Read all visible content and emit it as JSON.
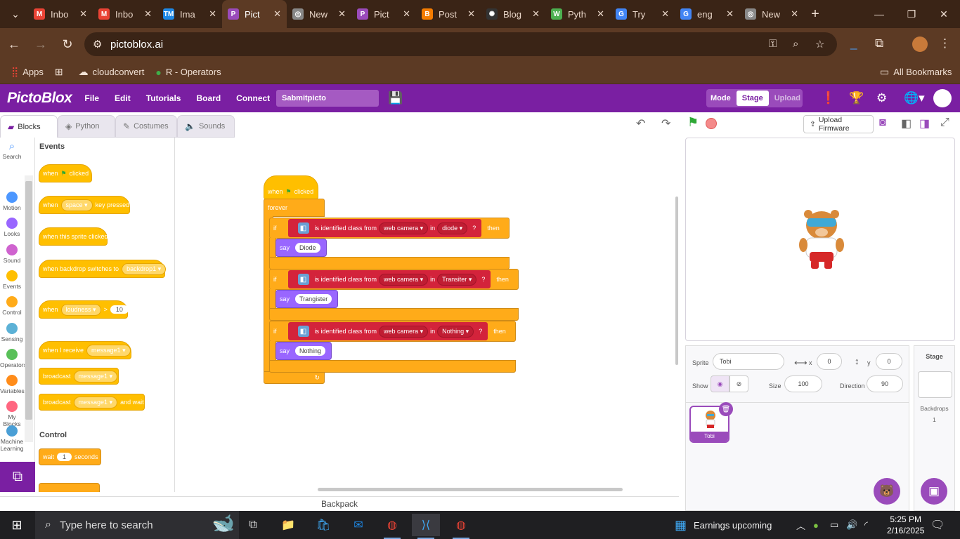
{
  "browser": {
    "tabs": [
      {
        "title": "Inbo",
        "icon": "gmail-icon",
        "color": "#ea4335",
        "glyph": "M"
      },
      {
        "title": "Inbo",
        "icon": "gmail-icon",
        "color": "#ea4335",
        "glyph": "M"
      },
      {
        "title": "Ima",
        "icon": "tm-icon",
        "color": "#1e88e5",
        "glyph": "TM"
      },
      {
        "title": "Pict",
        "icon": "pictoblox-icon",
        "color": "#9a4bbb",
        "glyph": "P",
        "active": true
      },
      {
        "title": "New",
        "icon": "chrome-icon",
        "color": "#888888",
        "glyph": "◎"
      },
      {
        "title": "Pict",
        "icon": "pictoblox-icon",
        "color": "#9a4bbb",
        "glyph": "P"
      },
      {
        "title": "Post",
        "icon": "blogger-icon",
        "color": "#f57c00",
        "glyph": "B"
      },
      {
        "title": "Blog",
        "icon": "openai-icon",
        "color": "#333333",
        "glyph": "✺"
      },
      {
        "title": "Pyth",
        "icon": "w3-icon",
        "color": "#4caf50",
        "glyph": "W"
      },
      {
        "title": "Try",
        "icon": "google-icon",
        "color": "#4285f4",
        "glyph": "G"
      },
      {
        "title": "eng",
        "icon": "google-icon",
        "color": "#4285f4",
        "glyph": "G"
      },
      {
        "title": "New",
        "icon": "chrome-icon",
        "color": "#888888",
        "glyph": "◎"
      }
    ],
    "url": "pictoblox.ai",
    "bookmarks": [
      {
        "label": "Apps",
        "icon": "apps-grid-icon"
      },
      {
        "label": "",
        "icon": "tab-groups-icon"
      },
      {
        "label": "cloudconvert",
        "icon": "cloud-icon"
      },
      {
        "label": "R - Operators",
        "icon": "r-icon"
      }
    ],
    "all_bookmarks": "All Bookmarks"
  },
  "header": {
    "logo": "PictoBlox",
    "menus": [
      "File",
      "Edit",
      "Tutorials",
      "Board",
      "Connect"
    ],
    "project_name": "Sabmitpicto",
    "mode_label": "Mode",
    "mode_stage": "Stage",
    "mode_upload": "Upload"
  },
  "code_tabs": [
    "Blocks",
    "Python",
    "Costumes",
    "Sounds"
  ],
  "categories": [
    {
      "label": "Search",
      "color": ""
    },
    {
      "label": "Motion",
      "color": "#4c97ff"
    },
    {
      "label": "Looks",
      "color": "#9966ff"
    },
    {
      "label": "Sound",
      "color": "#cf63cf"
    },
    {
      "label": "Events",
      "color": "#ffbf00"
    },
    {
      "label": "Control",
      "color": "#ffab19"
    },
    {
      "label": "Sensing",
      "color": "#5cb1d6"
    },
    {
      "label": "Operators",
      "color": "#59c059"
    },
    {
      "label": "Variables",
      "color": "#ff8c1a"
    },
    {
      "label": "My Blocks",
      "color": "#ff6680"
    },
    {
      "label": "Machine Learning",
      "color": "#4a9fd6"
    }
  ],
  "palette": {
    "events_title": "Events",
    "control_title": "Control",
    "when": "when",
    "clicked": "clicked",
    "space": "space",
    "key_pressed": "key pressed",
    "sprite_clicked": "when this sprite clicked",
    "backdrop_switches": "when backdrop switches to",
    "backdrop1": "backdrop1",
    "loudness": "loudness",
    "gt": ">",
    "ten": "10",
    "receive": "when I receive",
    "message1": "message1",
    "broadcast": "broadcast",
    "and_wait": "and wait",
    "wait": "wait",
    "one": "1",
    "seconds": "seconds"
  },
  "script": {
    "when": "when",
    "clicked": "clicked",
    "forever": "forever",
    "if": "if",
    "then": "then",
    "say": "say",
    "identified": "is identified class from",
    "source": "web camera",
    "in": "in",
    "q": "?",
    "branches": [
      {
        "class": "diode",
        "say": "Diode"
      },
      {
        "class": "Transiter",
        "say": "Trangister"
      },
      {
        "class": "Nothing",
        "say": "Nothing"
      }
    ]
  },
  "backpack": "Backpack",
  "stage_panel": {
    "upload_firmware": "Upload Firmware",
    "sprite_label": "Sprite",
    "sprite_name": "Tobi",
    "x_label": "x",
    "x": "0",
    "y_label": "y",
    "y": "0",
    "show_label": "Show",
    "size_label": "Size",
    "size": "100",
    "direction_label": "Direction",
    "direction": "90",
    "tile_name": "Tobi",
    "stage_title": "Stage",
    "backdrops_label": "Backdrops",
    "backdrops_count": "1"
  },
  "taskbar": {
    "search_placeholder": "Type here to search",
    "news": "Earnings upcoming",
    "time": "5:25 PM",
    "date": "2/16/2025"
  }
}
